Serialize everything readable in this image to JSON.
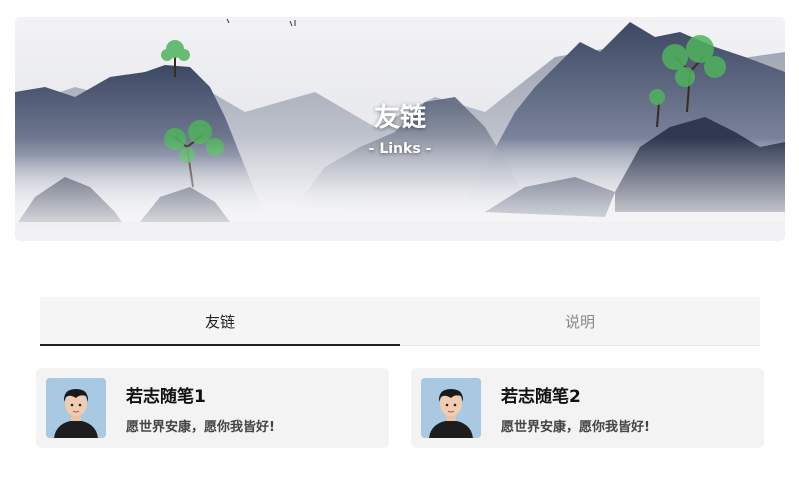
{
  "banner": {
    "title": "友链",
    "subtitle": "- Links -"
  },
  "tabs": [
    {
      "label": "友链",
      "active": true
    },
    {
      "label": "说明",
      "active": false
    }
  ],
  "links": [
    {
      "name": "若志随笔1",
      "description": "愿世界安康，愿你我皆好!",
      "avatar_icon": "avatar-icon"
    },
    {
      "name": "若志随笔2",
      "description": "愿世界安康，愿你我皆好!",
      "avatar_icon": "avatar-icon"
    }
  ],
  "colors": {
    "tab_bg": "#f5f5f5",
    "card_bg": "#f3f3f3",
    "active_underline": "#222222",
    "avatar_bg": "#a9c9e2"
  }
}
